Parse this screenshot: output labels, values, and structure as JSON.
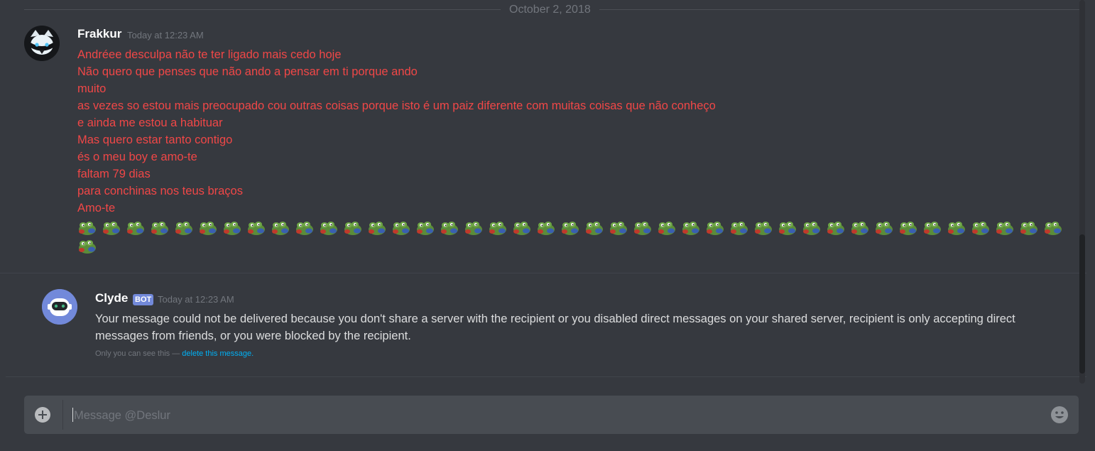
{
  "date_divider": "October 2, 2018",
  "messages": [
    {
      "author": "Frakkur",
      "timestamp": "Today at 12:23 AM",
      "lines": [
        "Andréee desculpa não te ter ligado mais cedo hoje",
        "Não quero que penses que não ando a pensar em ti porque ando",
        "muito",
        "as vezes so estou mais preocupado cou outras coisas porque isto é um paiz diferente com muitas coisas que não conheço",
        "e ainda me estou a habituar",
        "Mas quero estar tanto contigo",
        "és o meu boy e amo-te",
        "faltam 79 dias",
        "para conchinas nos teus braços",
        "Amo-te"
      ],
      "emoji_name": "pepe-hug-emoji",
      "emoji_count": 42
    },
    {
      "author": "Clyde",
      "badge": "BOT",
      "timestamp": "Today at 12:23 AM",
      "text": "Your message could not be delivered because you don't share a server with the recipient or you disabled direct messages on your shared server, recipient is only accepting direct messages from friends, or you were blocked by the recipient.",
      "ephemeral_note": "Only you can see this — ",
      "ephemeral_link": "delete this message."
    }
  ],
  "composer": {
    "placeholder": "Message @Deslur"
  },
  "colors": {
    "background": "#36393f",
    "red_text": "#f04747",
    "link": "#00b0f4",
    "bot_badge": "#7289da"
  }
}
